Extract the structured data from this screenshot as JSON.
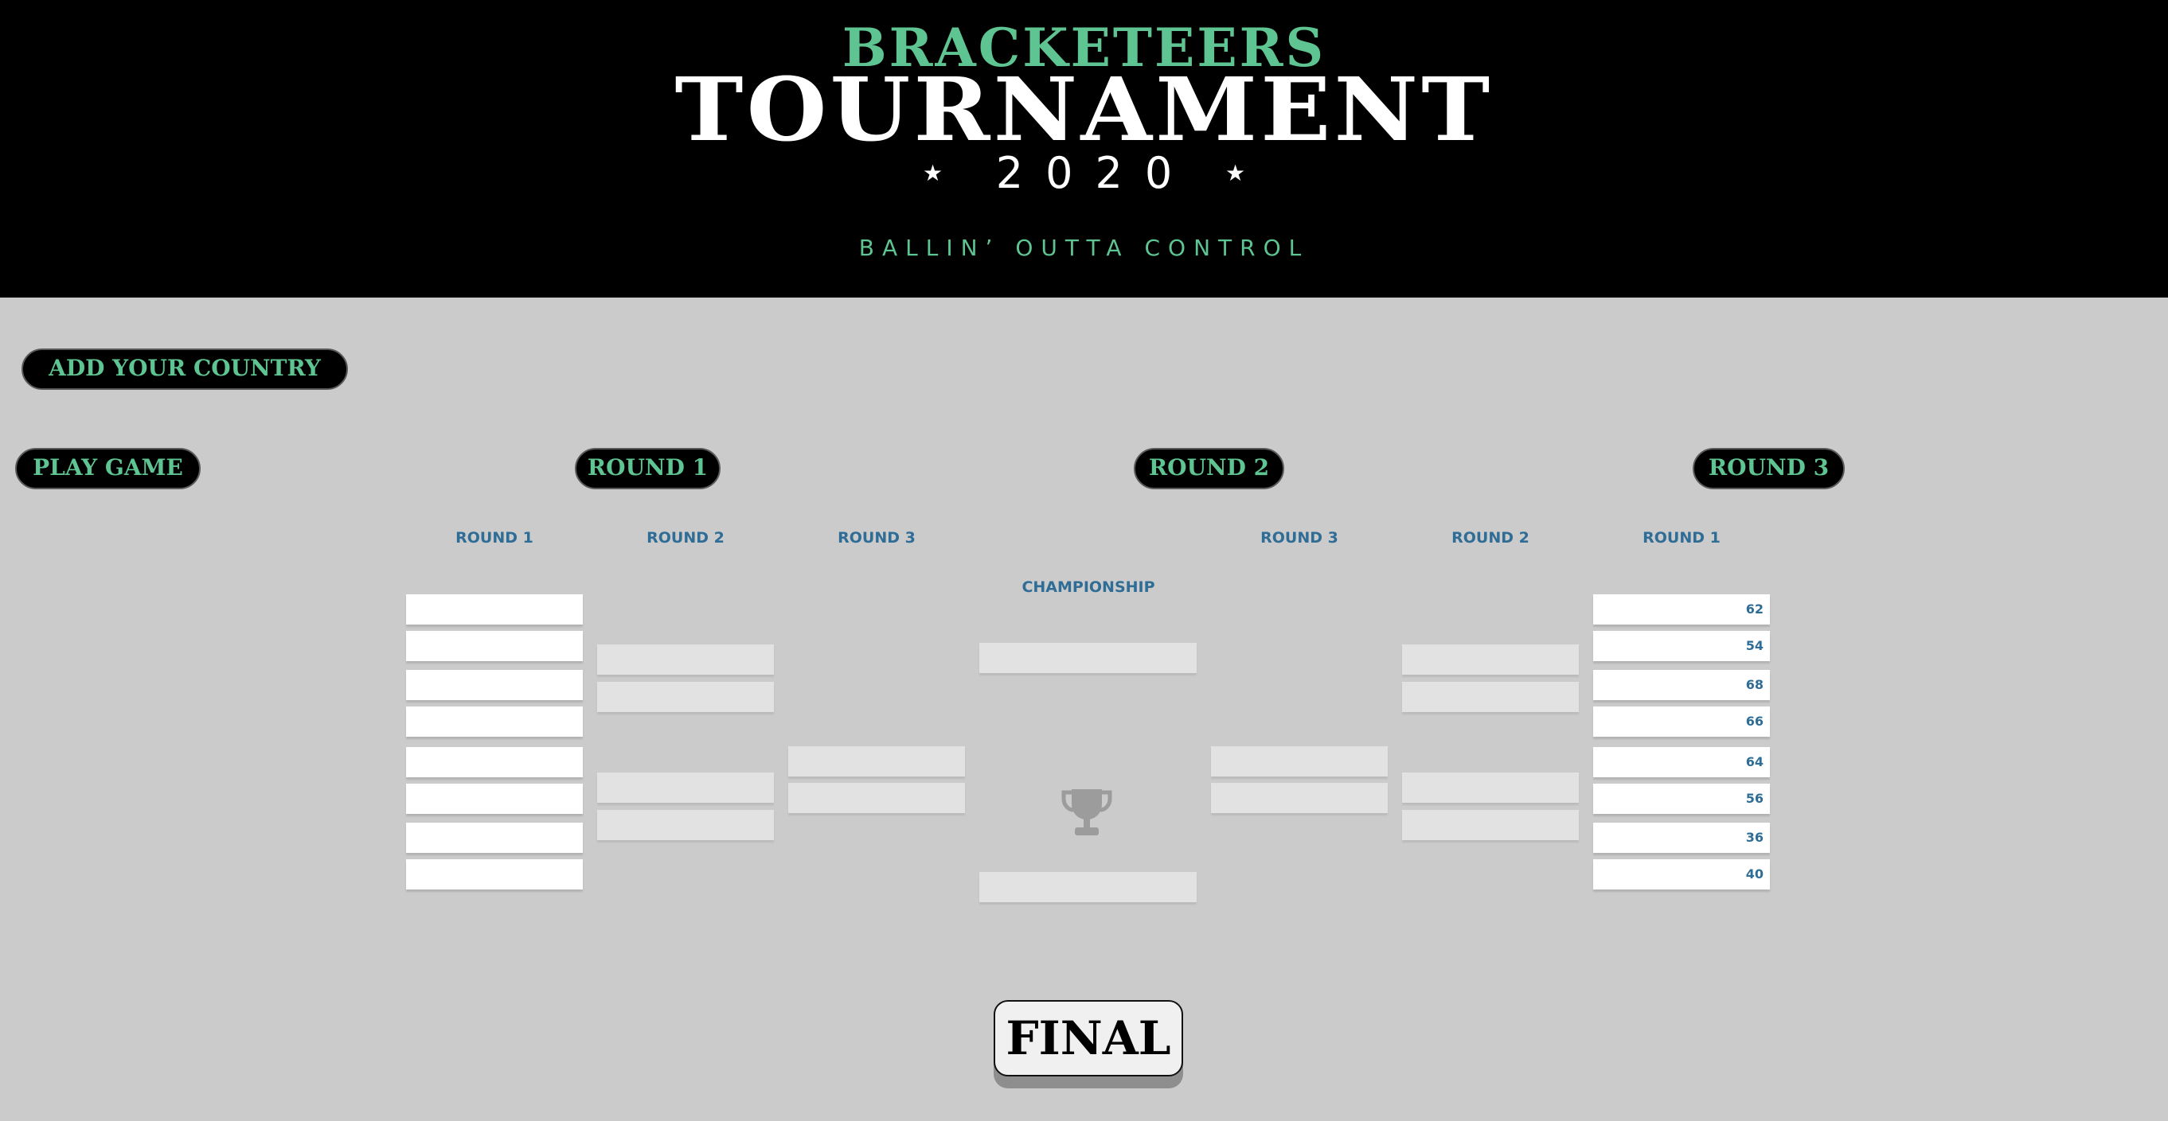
{
  "header": {
    "brand": "BRACKETEERS",
    "title": "TOURNAMENT",
    "year": "2020",
    "star": "★",
    "tagline": "BALLIN’ OUTTA CONTROL"
  },
  "buttons": {
    "add_country": "ADD YOUR COUNTRY",
    "play_game": "PLAY GAME",
    "round1": "ROUND 1",
    "round2": "ROUND 2",
    "round3": "ROUND 3",
    "final": "FINAL"
  },
  "bracket": {
    "left_labels": [
      "ROUND 1",
      "ROUND 2",
      "ROUND 3"
    ],
    "right_labels": [
      "ROUND 3",
      "ROUND 2",
      "ROUND 1"
    ],
    "championship": "CHAMPIONSHIP",
    "right_round1_scores": [
      "62",
      "54",
      "68",
      "66",
      "64",
      "56",
      "36",
      "40"
    ]
  },
  "colors": {
    "accent_green": "#5ec491",
    "label_blue": "#2f6d96",
    "background": "#cbcbcb"
  }
}
